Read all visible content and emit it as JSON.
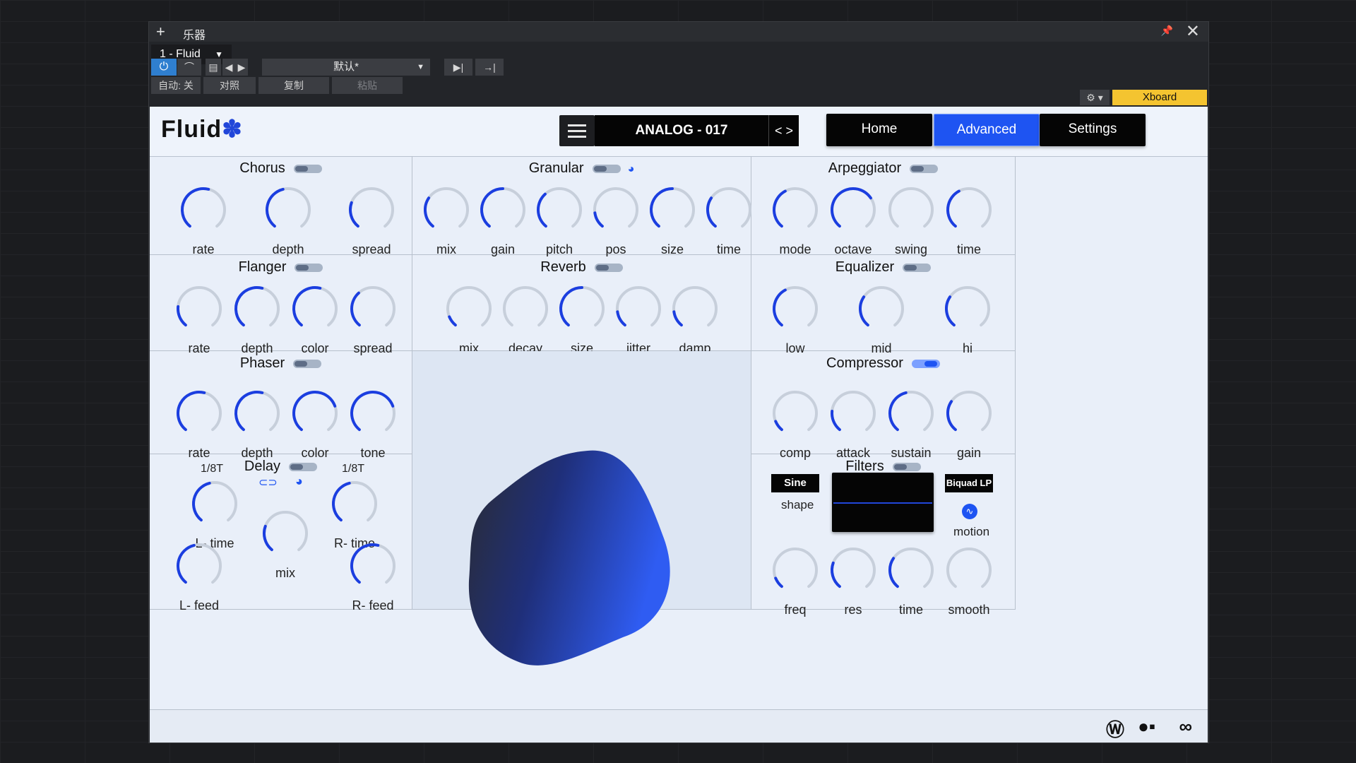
{
  "window": {
    "plus": "+",
    "title": "乐器",
    "pin": "📌",
    "close": "✕"
  },
  "instrument": {
    "name": "1 - Fluid",
    "caret": "▼"
  },
  "toolbar": {
    "power": "⏻",
    "auto": "自动: 关",
    "compare": "对照",
    "copy": "复制",
    "paste": "粘贴",
    "preset": "默认*",
    "preset_caret": "▼",
    "xboard": "Xboard",
    "gear": "⚙ ▾"
  },
  "plugin": {
    "logo": "Fluid",
    "preset_name": "ANALOG - 017",
    "arrows": "< >",
    "buttons": {
      "home": "Home",
      "advanced": "Advanced",
      "settings": "Settings"
    }
  },
  "sections": {
    "chorus": {
      "title": "Chorus",
      "knobs": [
        "rate",
        "depth",
        "spread"
      ],
      "levels": [
        0.55,
        0.45,
        0.25
      ]
    },
    "granular": {
      "title": "Granular",
      "knobs": [
        "mix",
        "gain",
        "pitch",
        "pos",
        "size",
        "time"
      ],
      "levels": [
        0.3,
        0.5,
        0.35,
        0.15,
        0.5,
        0.3
      ]
    },
    "arpeggiator": {
      "title": "Arpeggiator",
      "knobs": [
        "mode",
        "octave",
        "swing",
        "time"
      ],
      "levels": [
        0.4,
        0.7,
        0.0,
        0.4
      ]
    },
    "flanger": {
      "title": "Flanger",
      "knobs": [
        "rate",
        "depth",
        "color",
        "spread"
      ],
      "levels": [
        0.2,
        0.55,
        0.55,
        0.35
      ]
    },
    "reverb": {
      "title": "Reverb",
      "knobs": [
        "mix",
        "decay",
        "size",
        "jitter",
        "damp"
      ],
      "levels": [
        0.1,
        0.0,
        0.5,
        0.15,
        0.15
      ]
    },
    "equalizer": {
      "title": "Equalizer",
      "knobs": [
        "low",
        "mid",
        "hi"
      ],
      "levels": [
        0.4,
        0.3,
        0.3
      ]
    },
    "phaser": {
      "title": "Phaser",
      "knobs": [
        "rate",
        "depth",
        "color",
        "tone"
      ],
      "levels": [
        0.55,
        0.55,
        0.75,
        0.75
      ]
    },
    "compressor": {
      "title": "Compressor",
      "knobs": [
        "comp",
        "attack",
        "sustain",
        "gain"
      ],
      "levels": [
        0.1,
        0.2,
        0.45,
        0.3
      ]
    },
    "delay": {
      "title": "Delay",
      "left_sync": "1/8T",
      "right_sync": "1/8T",
      "knobs": {
        "l_time": "L- time",
        "r_time": "R- time",
        "mix": "mix",
        "l_feed": "L- feed",
        "r_feed": "R- feed"
      },
      "levels": [
        0.45,
        0.45,
        0.25,
        0.45,
        0.55
      ]
    },
    "filters": {
      "title": "Filters",
      "shape_value": "Sine",
      "shape_label": "shape",
      "type_value": "Biquad LP",
      "motion_label": "motion",
      "knobs": [
        "freq",
        "res",
        "time",
        "smooth"
      ],
      "levels": [
        0.1,
        0.25,
        0.3,
        0.0
      ]
    }
  },
  "colors": {
    "accent": "#1e54f2",
    "knob_track": "#c7cfdb",
    "knob_fill": "#1b3ee0"
  },
  "footer_icons": [
    "waves-logo-icon",
    "brand-mark-icon",
    "infinity-link-icon"
  ]
}
